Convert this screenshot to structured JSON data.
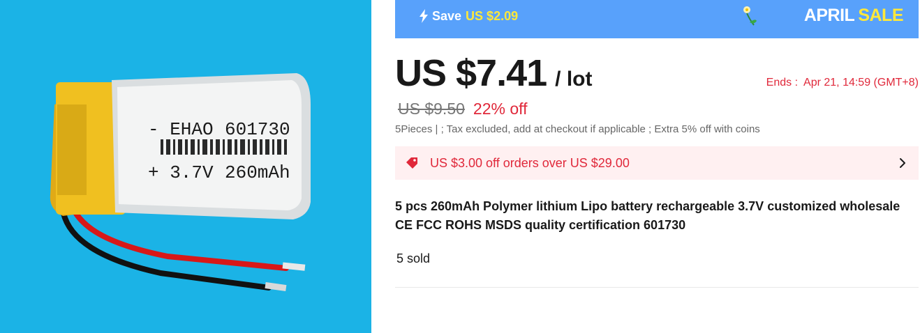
{
  "banner": {
    "save_label": "Save",
    "save_amount": "US $2.09",
    "sale_word1": "APRIL",
    "sale_word2": "SALE",
    "icons": [
      "bolt-icon",
      "flower-icon"
    ],
    "colors": {
      "banner_bg": "#58a1fb",
      "highlight": "#ffe83a"
    }
  },
  "price": {
    "current": "US $7.41",
    "unit": "/ lot",
    "original": "US $9.50",
    "discount": "22% off",
    "ends_label": "Ends :",
    "ends_time": "Apr 21, 14:59 (GMT+8)"
  },
  "tax_line": "5Pieces | ; Tax excluded, add at checkout if applicable ; Extra 5% off with coins",
  "coupon": {
    "text": "US $3.00 off orders over US $29.00",
    "icons": [
      "tag-icon",
      "chevron-right-icon"
    ],
    "color": "#e0283a"
  },
  "product": {
    "title": "5 pcs 260mAh Polymer lithium Lipo battery rechargeable 3.7V customized wholesale CE FCC ROHS MSDS quality certification 601730",
    "sold": "5 sold"
  },
  "image": {
    "label_line1_left": "- EHAO",
    "label_line1_right": "601730",
    "label_line2_left": "+ 3.7V",
    "label_line2_right": "260mAh"
  }
}
